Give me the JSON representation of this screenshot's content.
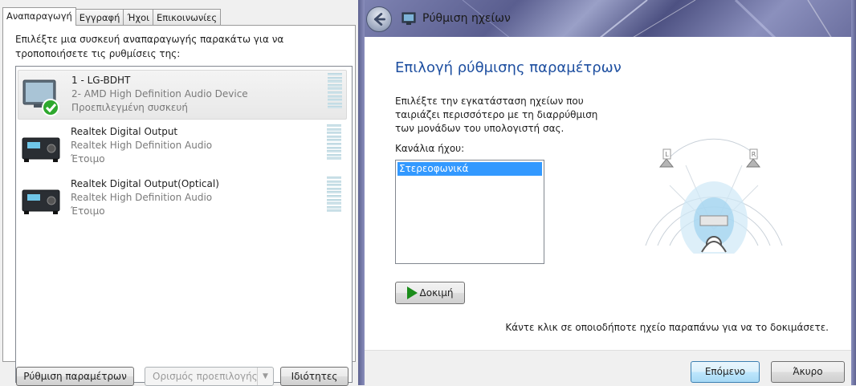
{
  "left_dialog": {
    "tabs": [
      "Αναπαραγωγή",
      "Εγγραφή",
      "Ήχοι",
      "Επικοινωνίες"
    ],
    "instruction": "Επιλέξτε μια συσκευή αναπαραγωγής παρακάτω για να τροποποιήσετε τις ρυθμίσεις της:",
    "devices": [
      {
        "name": "1 - LG-BDHT",
        "driver": "2- AMD High Definition Audio Device",
        "status": "Προεπιλεγμένη συσκευή",
        "icon": "monitor-icon"
      },
      {
        "name": "Realtek Digital Output",
        "driver": "Realtek High Definition Audio",
        "status": "Έτοιμο",
        "icon": "digital-output-icon"
      },
      {
        "name": "Realtek Digital Output(Optical)",
        "driver": "Realtek High Definition Audio",
        "status": "Έτοιμο",
        "icon": "digital-output-icon"
      }
    ],
    "buttons": {
      "configure": "Ρύθμιση παραμέτρων",
      "set_default": "Ορισμός προεπιλογής",
      "properties": "Ιδιότητες"
    }
  },
  "wizard": {
    "window_title": "Ρύθμιση ηχείων",
    "heading": "Επιλογή ρύθμισης παραμέτρων",
    "description": "Επιλέξτε την εγκατάσταση ηχείων που ταιριάζει περισσότερο με τη διαρρύθμιση των μονάδων του υπολογιστή σας.",
    "channels_label": "Κανάλια ήχου:",
    "channels": [
      "Στερεοφωνικά"
    ],
    "selected_channel": "Στερεοφωνικά",
    "test_button": "Δοκιμή",
    "hint": "Κάντε κλικ σε οποιοδήποτε ηχείο παραπάνω για να το δοκιμάσετε.",
    "speaker_left_label": "L",
    "speaker_right_label": "R",
    "next_button": "Επόμενο",
    "cancel_button": "Άκυρο"
  },
  "colors": {
    "heading": "#1e4fa0",
    "selection": "#3399ff",
    "play": "#1a8c1a"
  }
}
